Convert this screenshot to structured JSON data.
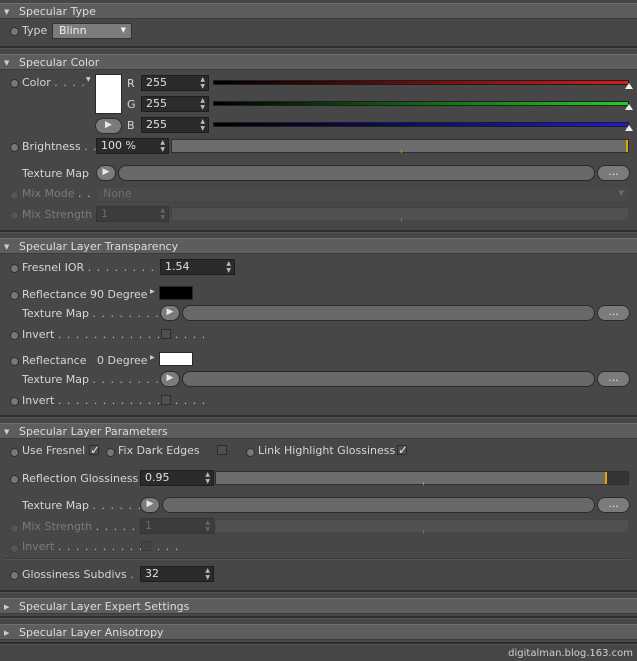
{
  "sections": {
    "specular_type": "Specular Type",
    "specular_color": "Specular Color",
    "specular_layer_transparency": "Specular Layer Transparency",
    "specular_layer_parameters": "Specular Layer Parameters",
    "specular_layer_expert_settings": "Specular Layer Expert Settings",
    "specular_layer_anisotropy": "Specular Layer Anisotropy"
  },
  "specular_type": {
    "type_label": "Type",
    "type_value": "Blinn"
  },
  "specular_color": {
    "color_label": "Color",
    "color_dots": ". . . .",
    "r_label": "R",
    "g_label": "G",
    "b_label": "B",
    "r_value": "255",
    "g_value": "255",
    "b_value": "255",
    "brightness_label": "Brightness",
    "brightness_dots": ". .",
    "brightness_value": "100 %",
    "texture_map_label": "Texture Map",
    "texture_map_button": "...",
    "mix_mode_label": "Mix Mode",
    "mix_mode_dots": ". .",
    "mix_mode_value": "None",
    "mix_strength_label": "Mix Strength",
    "mix_strength_value": "1"
  },
  "specular_layer_transparency": {
    "fresnel_ior_label": "Fresnel IOR",
    "fresnel_ior_dots": ". . . . . . . . . . . .",
    "fresnel_ior_value": "1.54",
    "reflectance90_label": "Reflectance 90 Degree",
    "texture_map1_label": "Texture Map",
    "texture_map1_dots": ". . . . . . . . . . .",
    "texture_map1_button": "...",
    "invert1_label": "Invert",
    "invert1_dots": ". . . . . . . . . . . . . . . . .",
    "reflectance0_label": "Reflectance   0 Degree",
    "texture_map2_label": "Texture Map",
    "texture_map2_dots": ". . . . . . . . . . .",
    "texture_map2_button": "...",
    "invert2_label": "Invert",
    "invert2_dots": ". . . . . . . . . . . . . . . . ."
  },
  "specular_layer_parameters": {
    "use_fresnel_label": "Use Fresnel",
    "fix_dark_edges_label": "Fix Dark Edges",
    "link_highlight_label": "Link Highlight Glossiness",
    "checkmark": "✓",
    "reflection_glossiness_label": "Reflection Glossiness",
    "reflection_glossiness_value": "0.95",
    "texture_map_label": "Texture Map",
    "texture_map_dots": ". . . . . . . . .",
    "texture_map_button": "...",
    "mix_strength_label": "Mix Strength",
    "mix_strength_dots": ". . . . . . . .",
    "mix_strength_value": "1",
    "invert_label": "Invert",
    "invert_dots": ". . . . . . . . . . . . . .",
    "glossiness_subdivs_label": "Glossiness Subdivs",
    "glossiness_subdivs_dots": ". .",
    "glossiness_subdivs_value": "32"
  },
  "levels": {
    "r": 1.0,
    "g": 1.0,
    "b": 1.0,
    "brightness": 1.0,
    "reflection_glossiness": 0.95
  },
  "colors": {
    "color_swatch": "#ffffff",
    "reflectance90_swatch": "#000000",
    "reflectance0_swatch": "#ffffff",
    "r_bar": "#d81c1c",
    "g_bar": "#1fd01f",
    "b_bar": "#1c1cd6",
    "accent": "#e2a400"
  },
  "footer": "digitalman.blog.163.com"
}
